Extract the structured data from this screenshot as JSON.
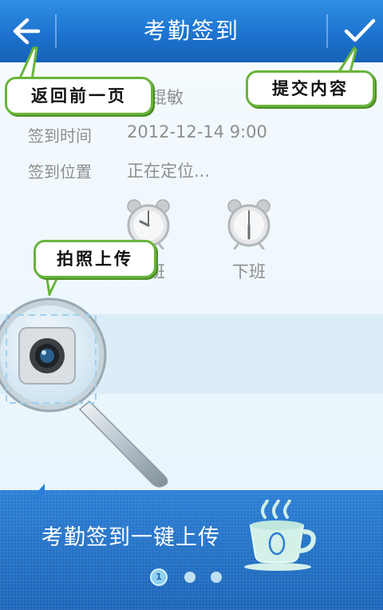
{
  "header": {
    "title": "考勤签到",
    "back_icon": "back-arrow-icon",
    "submit_icon": "checkmark-icon"
  },
  "form": {
    "name_value_partial": "锟敏",
    "time_label": "签到时间",
    "time_value": "2012-12-14 9:00",
    "location_label": "签到位置",
    "location_value": "正在定位..."
  },
  "clocks": {
    "on_duty_partial": "上班",
    "off_duty": "下班"
  },
  "tooltips": {
    "back": "返回前一页",
    "submit": "提交内容",
    "photo": "拍照上传"
  },
  "footer": {
    "slogan": "考勤签到一键上传",
    "page_current": "1"
  },
  "colors": {
    "header_blue": "#1d73cf",
    "callout_green": "#69b43b",
    "footer_blue": "#1a64b8"
  }
}
